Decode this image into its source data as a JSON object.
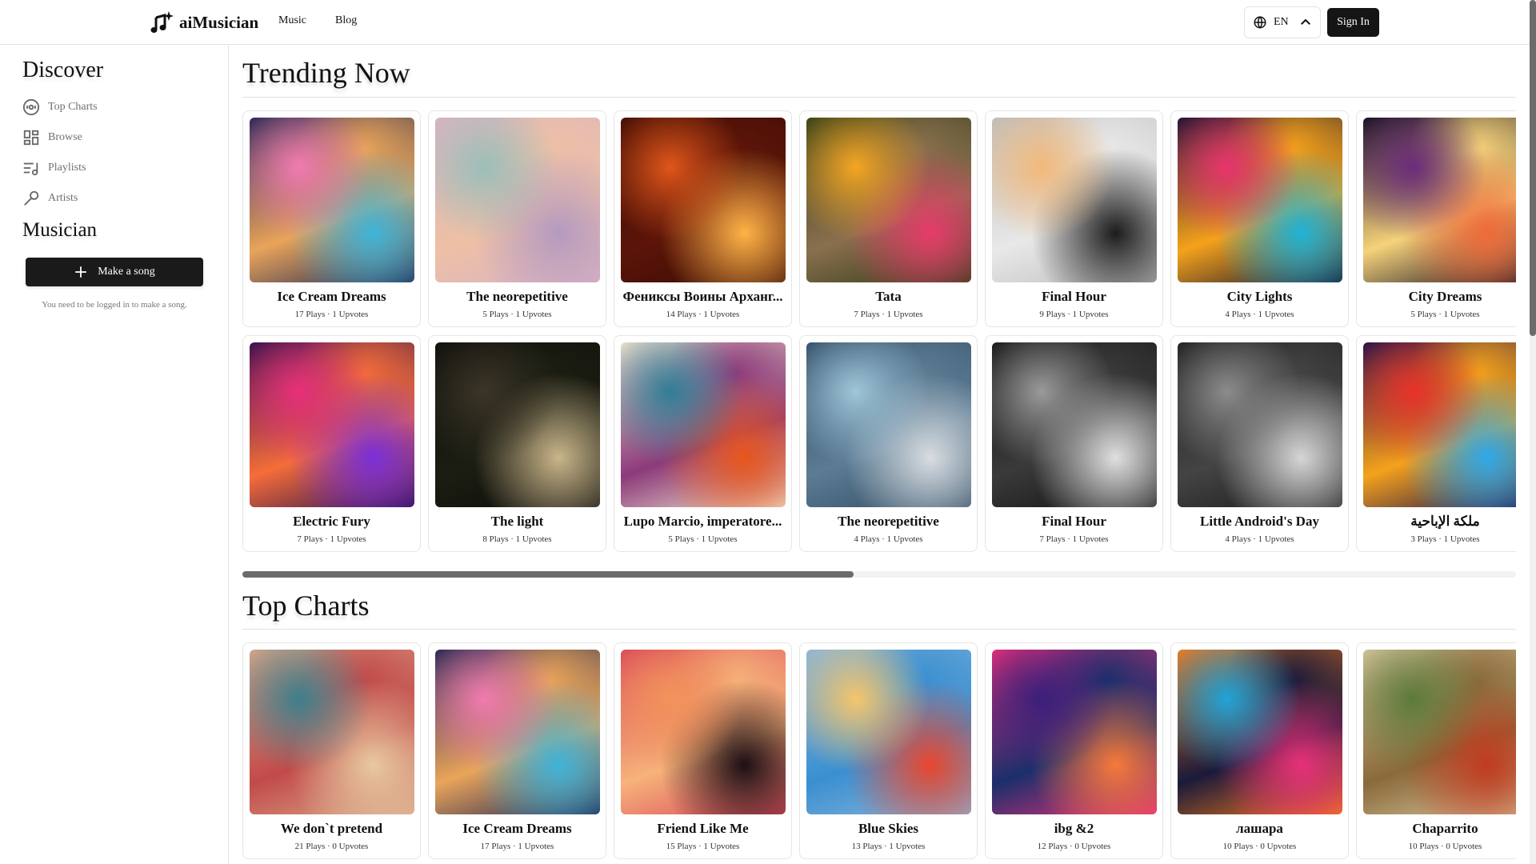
{
  "header": {
    "logo_text": "aiMusician",
    "nav": [
      {
        "label": "Music"
      },
      {
        "label": "Blog"
      }
    ],
    "language": {
      "icon": "globe-icon",
      "value": "EN",
      "chevron": "chevron-up-icon"
    },
    "sign_in_label": "Sign In"
  },
  "sidebar": {
    "discover_heading": "Discover",
    "items": [
      {
        "label": "Top Charts",
        "icon": "disc-icon"
      },
      {
        "label": "Browse",
        "icon": "grid-icon"
      },
      {
        "label": "Playlists",
        "icon": "playlist-icon"
      },
      {
        "label": "Artists",
        "icon": "microphone-icon"
      }
    ],
    "musician_heading": "Musician",
    "make_song_label": "Make a song",
    "login_note": "You need to be logged in to make a song."
  },
  "trending": {
    "title": "Trending Now",
    "scroll_fraction_visible": 0.48,
    "rows": [
      [
        {
          "title": "Ice Cream Dreams",
          "stats": "17 Plays · 1 Upvotes",
          "palette": [
            "#1d2350",
            "#f27bb0",
            "#3fb4d8",
            "#e9a45a"
          ]
        },
        {
          "title": "The neorepetitive",
          "stats": "5 Plays · 1 Upvotes",
          "palette": [
            "#d9b3c4",
            "#9bbfb9",
            "#b59ac0",
            "#eec0a5"
          ]
        },
        {
          "title": "Фениксы Воины Арханг...",
          "stats": "14 Plays · 1 Upvotes",
          "palette": [
            "#3a0a04",
            "#e0561a",
            "#ffb347",
            "#5c1508"
          ]
        },
        {
          "title": "Tata",
          "stats": "7 Plays · 1 Upvotes",
          "palette": [
            "#2c3b16",
            "#f5a623",
            "#e63c6a",
            "#8a6f4d"
          ]
        },
        {
          "title": "Final Hour",
          "stats": "9 Plays · 1 Upvotes",
          "palette": [
            "#bdbdbd",
            "#f2b97a",
            "#1c1c1c",
            "#e8e8e8"
          ]
        },
        {
          "title": "City Lights",
          "stats": "4 Plays · 1 Upvotes",
          "palette": [
            "#13102e",
            "#e8346e",
            "#1fb3d6",
            "#f5a21b"
          ]
        },
        {
          "title": "City Dreams",
          "stats": "5 Plays · 1 Upvotes",
          "palette": [
            "#151020",
            "#6b2c7a",
            "#f06a3a",
            "#f5d27a"
          ]
        }
      ],
      [
        {
          "title": "Electric Fury",
          "stats": "7 Plays · 1 Upvotes",
          "palette": [
            "#2a0f4a",
            "#e8307a",
            "#7b2fd8",
            "#f56d3a"
          ]
        },
        {
          "title": "The light",
          "stats": "8 Plays · 1 Upvotes",
          "palette": [
            "#0e0e0b",
            "#3b3527",
            "#c9b58a",
            "#1b1d12"
          ]
        },
        {
          "title": "Lupo Marcio, imperatore...",
          "stats": "5 Plays · 1 Upvotes",
          "palette": [
            "#f1e6cf",
            "#2f7e96",
            "#e8561c",
            "#8c3a7a"
          ]
        },
        {
          "title": "The neorepetitive",
          "stats": "4 Plays · 1 Upvotes",
          "palette": [
            "#2f4b63",
            "#9fc6da",
            "#d8dde1",
            "#5c7c94"
          ]
        },
        {
          "title": "Final Hour",
          "stats": "7 Plays · 1 Upvotes",
          "palette": [
            "#121212",
            "#9a9a9a",
            "#e0e0e0",
            "#3a3a3a"
          ]
        },
        {
          "title": "Little Android's Day",
          "stats": "4 Plays · 1 Upvotes",
          "palette": [
            "#1a1a1a",
            "#8c8c8c",
            "#d6d6d6",
            "#444444"
          ]
        },
        {
          "title": "ملكة الإباحية",
          "stats": "3 Plays · 1 Upvotes",
          "palette": [
            "#1b0f4a",
            "#e8332a",
            "#2fa9e8",
            "#f5a21b"
          ]
        }
      ]
    ]
  },
  "top_charts": {
    "title": "Top Charts",
    "rows": [
      [
        {
          "title": "We don`t pretend",
          "stats": "21 Plays · 0 Upvotes",
          "palette": [
            "#d9a98a",
            "#3d7f8c",
            "#e8c9a0",
            "#c24a4a"
          ]
        },
        {
          "title": "Ice Cream Dreams",
          "stats": "17 Plays · 1 Upvotes",
          "palette": [
            "#1d2350",
            "#f27bb0",
            "#3fb4d8",
            "#e9a45a"
          ]
        },
        {
          "title": "Friend Like Me",
          "stats": "15 Plays · 1 Upvotes",
          "palette": [
            "#d9485a",
            "#f2935a",
            "#1c0f14",
            "#f7b27a"
          ]
        },
        {
          "title": "Blue Skies",
          "stats": "13 Plays · 1 Upvotes",
          "palette": [
            "#8bb6d9",
            "#f5c56a",
            "#e8462e",
            "#3a8fd1"
          ]
        },
        {
          "title": "ibg &2",
          "stats": "12 Plays · 0 Upvotes",
          "palette": [
            "#e8307a",
            "#3a1f7a",
            "#f57a3a",
            "#1a2f6b"
          ]
        },
        {
          "title": "лашара",
          "stats": "10 Plays · 0 Upvotes",
          "palette": [
            "#f57a1a",
            "#1fa3d8",
            "#e8307a",
            "#1a1a3a"
          ]
        },
        {
          "title": "Chaparrito",
          "stats": "10 Plays · 0 Upvotes",
          "palette": [
            "#d8c7a0",
            "#5c7a3a",
            "#c23a1f",
            "#8a6a3a"
          ]
        }
      ]
    ]
  }
}
